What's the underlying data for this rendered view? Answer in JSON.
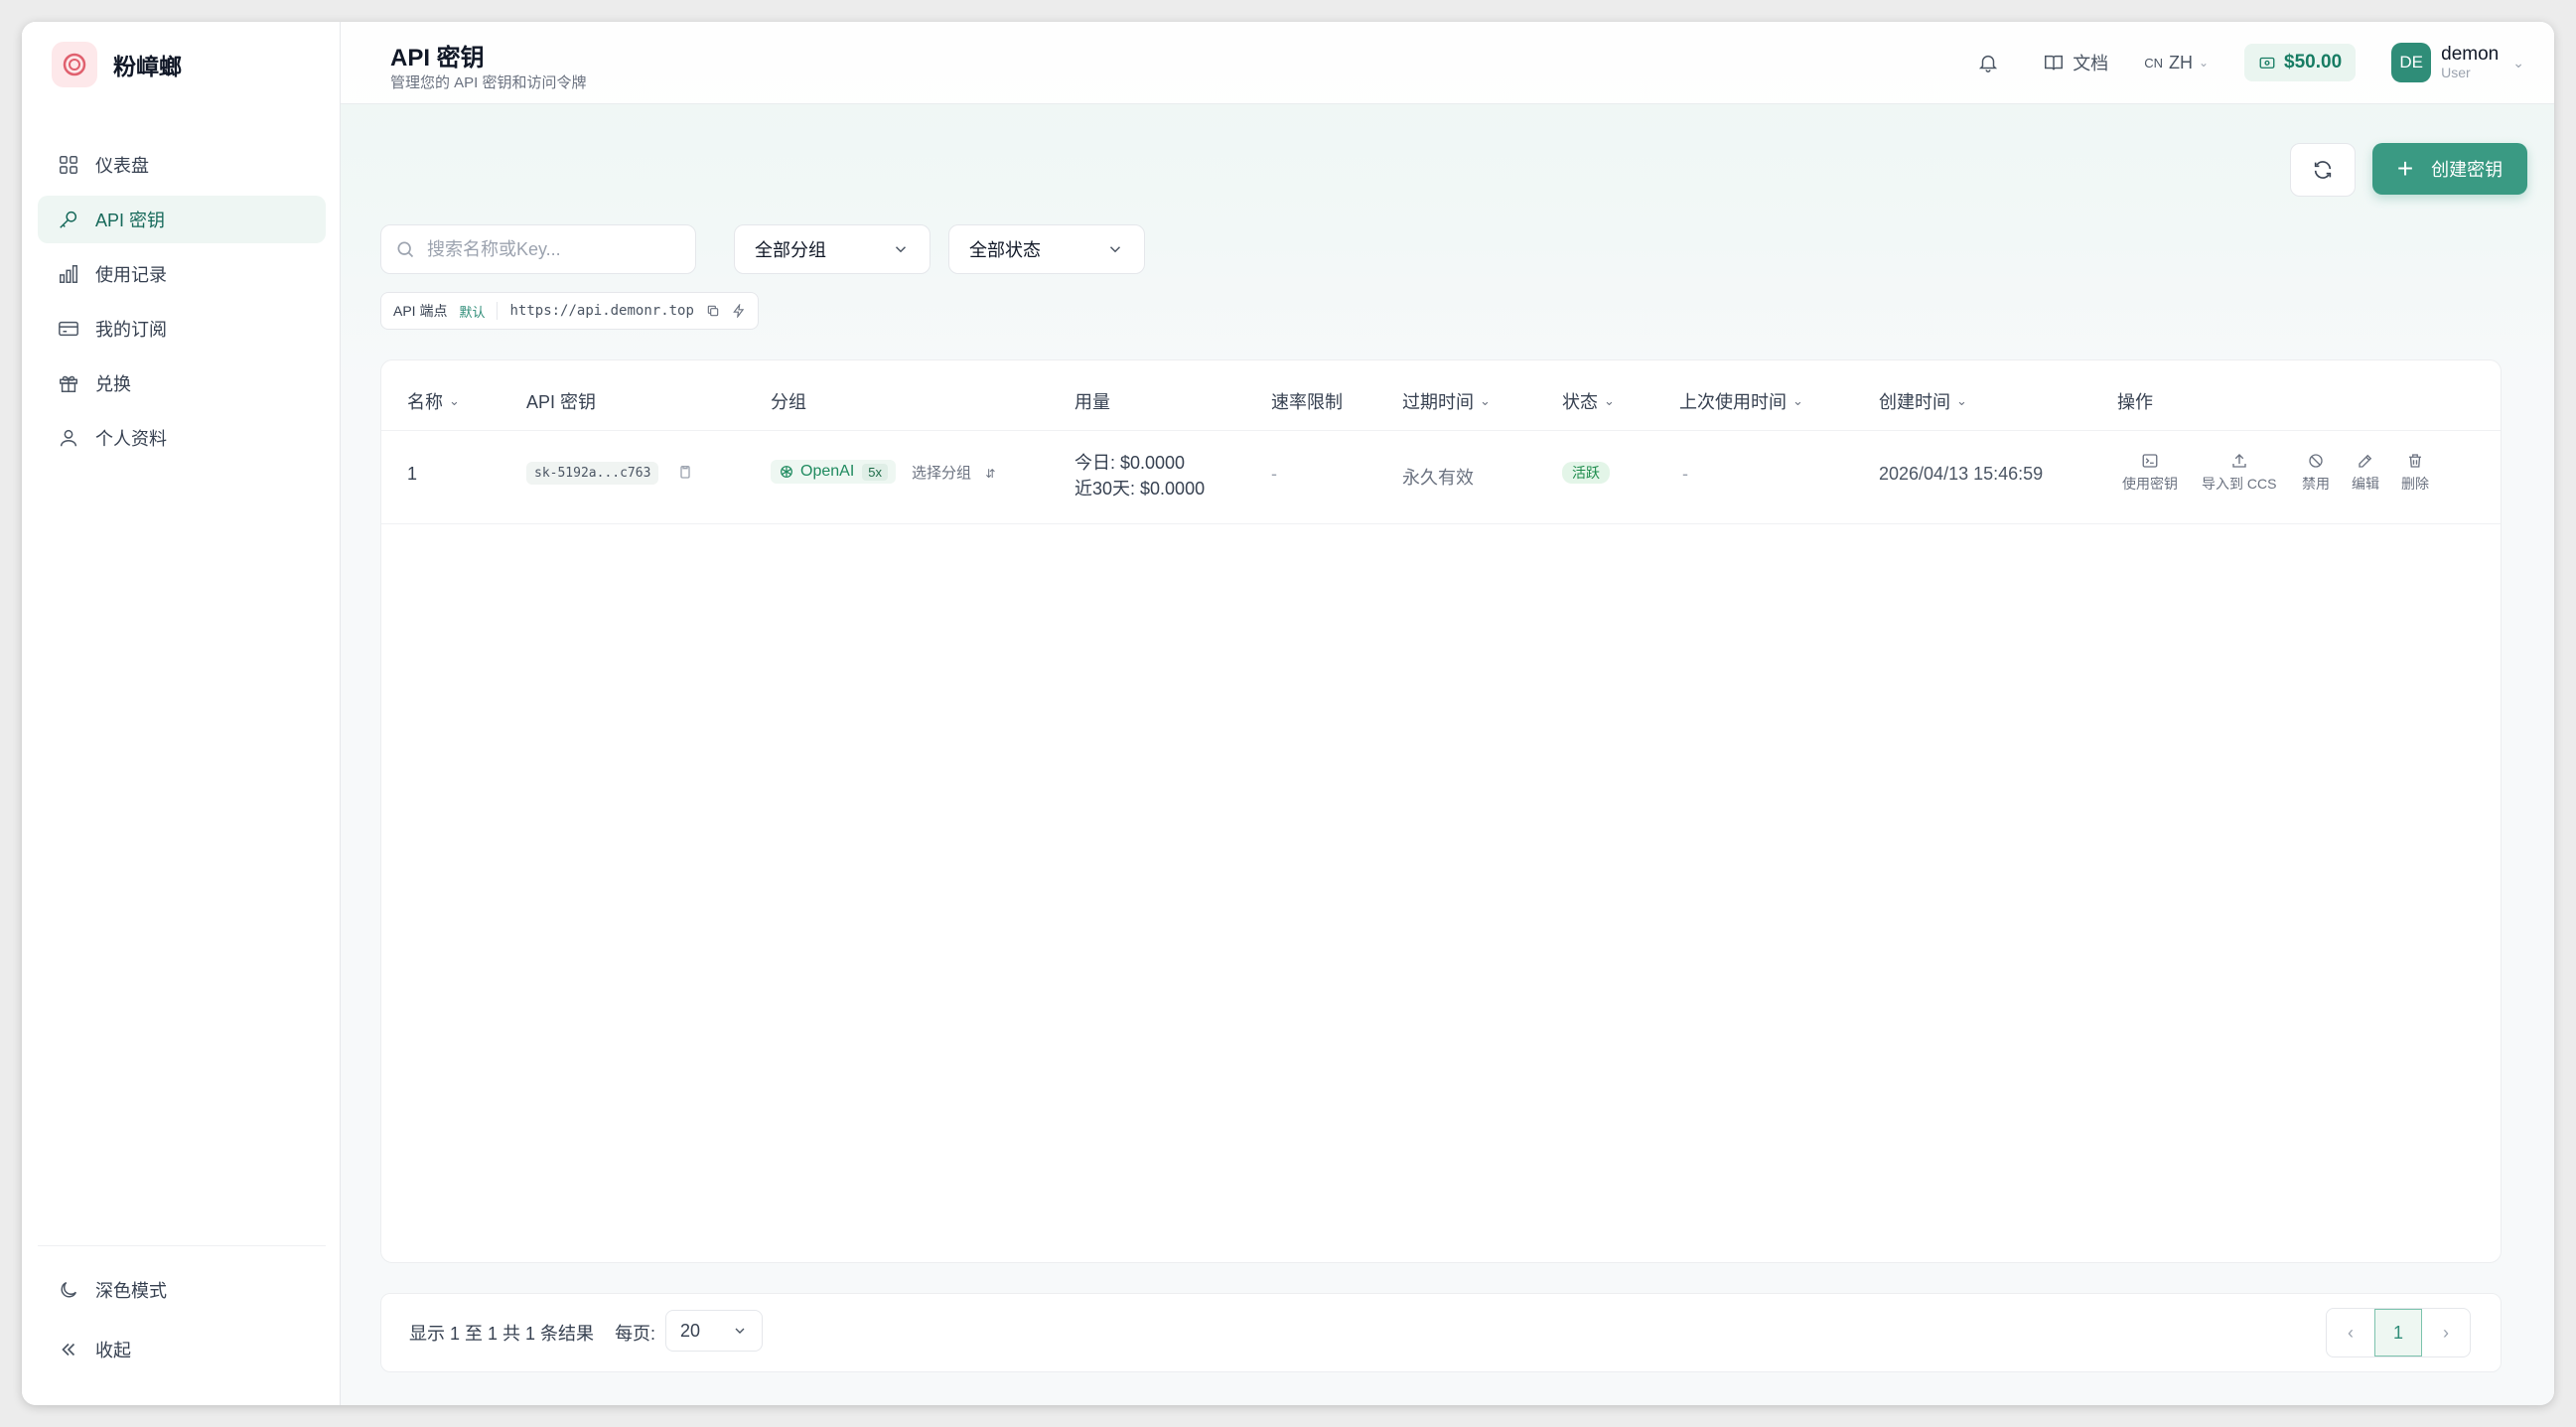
{
  "brand": {
    "name": "粉嶂螂"
  },
  "sidebar": {
    "items": [
      {
        "label": "仪表盘",
        "icon": "dashboard-icon"
      },
      {
        "label": "API 密钥",
        "icon": "key-icon",
        "active": true
      },
      {
        "label": "使用记录",
        "icon": "bar-chart-icon"
      },
      {
        "label": "我的订阅",
        "icon": "credit-card-icon"
      },
      {
        "label": "兑换",
        "icon": "gift-icon"
      },
      {
        "label": "个人资料",
        "icon": "user-icon"
      }
    ],
    "bottom": {
      "dark_mode": "深色模式",
      "collapse": "收起"
    }
  },
  "header": {
    "title": "API 密钥",
    "subtitle": "管理您的 API 密钥和访问令牌",
    "docs": "文档",
    "lang_code": "CN",
    "lang": "ZH",
    "balance": "$50.00",
    "user": {
      "initials": "DE",
      "name": "demon",
      "role": "User"
    }
  },
  "toolbar": {
    "create_label": "创建密钥",
    "search_placeholder": "搜索名称或Key...",
    "group_filter": "全部分组",
    "status_filter": "全部状态"
  },
  "endpoint": {
    "label": "API 端点",
    "default_badge": "默认",
    "url": "https://api.demonr.top"
  },
  "table": {
    "columns": [
      "名称",
      "API 密钥",
      "分组",
      "用量",
      "速率限制",
      "过期时间",
      "状态",
      "上次使用时间",
      "创建时间",
      "操作"
    ],
    "rows": [
      {
        "name": "1",
        "key": "sk-5192a...c763",
        "group": "OpenAI",
        "multiplier": "5x",
        "select_group": "选择分组",
        "usage_today": "今日: $0.0000",
        "usage_30d": "近30天: $0.0000",
        "rate_limit": "-",
        "expiry": "永久有效",
        "status": "活跃",
        "last_used": "-",
        "created": "2026/04/13 15:46:59"
      }
    ],
    "actions": [
      "使用密钥",
      "导入到 CCS",
      "禁用",
      "编辑",
      "删除"
    ]
  },
  "footer": {
    "summary": "显示 1 至 1 共 1 条结果",
    "per_page_label": "每页:",
    "per_page": "20",
    "current_page": "1"
  },
  "colors": {
    "accent": "#3a9a83",
    "active_bg": "#eef6f3",
    "status_green": "#1b8a4a"
  }
}
